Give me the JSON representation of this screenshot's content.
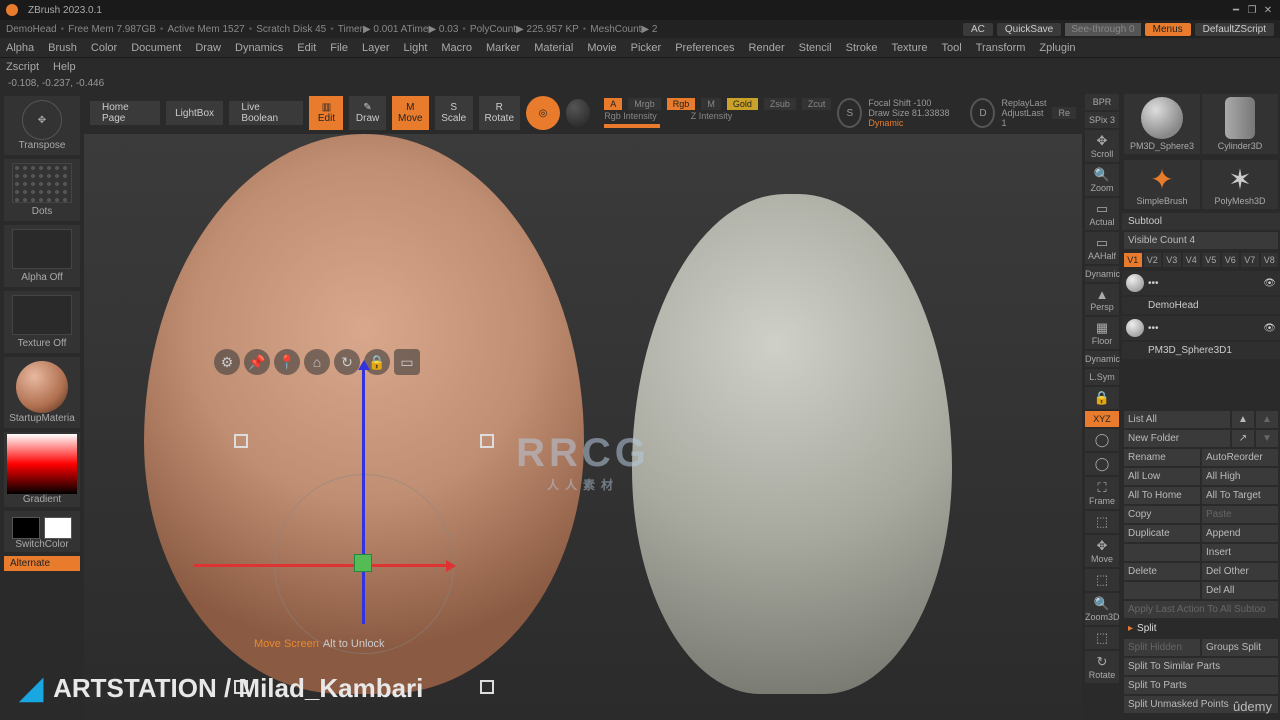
{
  "title": "ZBrush 2023.0.1",
  "title_doc": "DemoHead",
  "status": {
    "freemem": "Free Mem 7.987GB",
    "activemem": "Active Mem 1527",
    "scratch": "Scratch Disk 45",
    "timer": "Timer▶ 0.001 ATime▶ 0.03",
    "polycount": "PolyCount▶ 225.957 KP",
    "meshcount": "MeshCount▶ 2",
    "ac": "AC",
    "quicksave": "QuickSave",
    "seethrough": "See-through  0",
    "menus": "Menus",
    "defscript": "DefaultZScript"
  },
  "menu": [
    "Alpha",
    "Brush",
    "Color",
    "Document",
    "Draw",
    "Dynamics",
    "Edit",
    "File",
    "Layer",
    "Light",
    "Macro",
    "Marker",
    "Material",
    "Movie",
    "Picker",
    "Preferences",
    "Render",
    "Stencil",
    "Stroke",
    "Texture",
    "Tool",
    "Transform",
    "Zplugin"
  ],
  "menu2": [
    "Zscript",
    "Help"
  ],
  "coords": "-0.108, -0.237, -0.446",
  "toolbar": {
    "home": "Home Page",
    "lightbox": "LightBox",
    "livebool": "Live Boolean",
    "edit": "Edit",
    "draw": "Draw",
    "move": "Move",
    "scale": "Scale",
    "rotate": "Rotate",
    "sculptris": "",
    "a": "A",
    "mrgb": "Mrgb",
    "rgb": "Rgb",
    "m": "M",
    "gold": "Gold",
    "zsub": "Zsub",
    "zcut": "Zcut",
    "rgbintensity": "Rgb Intensity",
    "zintensity": "Z Intensity",
    "s": "S",
    "focal": "Focal Shift -100",
    "drawsize": "Draw Size  81.33838",
    "dynamic": "Dynamic",
    "d": "D",
    "replaylast": "ReplayLast",
    "adjustlast": "AdjustLast 1",
    "re": "Re"
  },
  "left": {
    "transpose": "Transpose",
    "dots": "Dots",
    "alphaoff": "Alpha Off",
    "textureoff": "Texture Off",
    "startupmat": "StartupMateria",
    "gradient": "Gradient",
    "switchcolor": "SwitchColor",
    "alternate": "Alternate"
  },
  "canvas_tools": [
    "BPR",
    "SPix 3",
    "Scroll",
    "Zoom",
    "Actual",
    "AAHalf",
    "Dynamic",
    "Persp",
    "Floor",
    "Dynamic",
    "L.Sym",
    "",
    "XYZ",
    "",
    "",
    "Frame",
    "",
    "Move",
    "",
    "Zoom3D",
    "",
    "Rotate"
  ],
  "right": {
    "tools": [
      "PM3D_Sphere3",
      "Cylinder3D",
      "SimpleBrush",
      "PolyMesh3D"
    ],
    "subtool": "Subtool",
    "visiblecnt": "Visible Count 4",
    "versions": [
      "V1",
      "V2",
      "V3",
      "V4",
      "V5",
      "V6",
      "V7",
      "V8"
    ],
    "layers": [
      "DemoHead",
      "PM3D_Sphere3D1"
    ],
    "listall": "List All",
    "newfolder": "New Folder",
    "ops": [
      [
        "Rename",
        "AutoReorder"
      ],
      [
        "All Low",
        "All High"
      ],
      [
        "All To Home",
        "All To Target"
      ],
      [
        "Copy",
        "Paste"
      ],
      [
        "Duplicate",
        "Append"
      ],
      [
        "",
        "Insert"
      ],
      [
        "Delete",
        "Del Other"
      ],
      [
        "",
        "Del All"
      ]
    ],
    "applylast": "Apply Last Action To All Subtoo",
    "split": "Split",
    "split_rows": [
      [
        "Split Hidden",
        "Groups Split"
      ],
      [
        "Split To Similar Parts",
        ""
      ],
      [
        "Split To Parts",
        ""
      ],
      [
        "Split Unmasked Points",
        ""
      ]
    ]
  },
  "overlay": {
    "move": "Move Screen",
    "alt": "Alt to Unlock"
  },
  "watermark": {
    "rrcg": "RRCG",
    "rrcg_sub": "人人素材",
    "artstation": "ARTSTATION / Milad_Kambari",
    "udemy": "ûdemy"
  }
}
